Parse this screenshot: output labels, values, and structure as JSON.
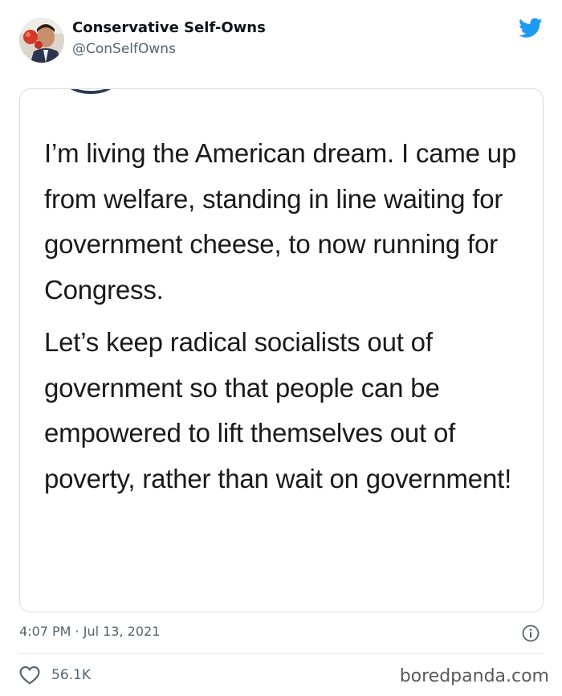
{
  "tweet": {
    "display_name": "Conservative Self-Owns",
    "handle": "@ConSelfOwns",
    "timestamp": "4:07 PM · Jul 13, 2021",
    "likes": "56.1K",
    "brand_color": "#1d9bf0"
  },
  "quoted_image": {
    "paragraph_1": "I’m living the American dream. I came up from welfare, standing in line waiting for government cheese, to now running for Congress.",
    "paragraph_2": "Let’s keep radical socialists out of government so that people can be empowered to lift themselves out of poverty, rather than wait on government!"
  },
  "watermark": "boredpanda.com",
  "icons": {
    "platform": "twitter-bird-icon",
    "info": "info-icon",
    "like": "heart-icon"
  }
}
